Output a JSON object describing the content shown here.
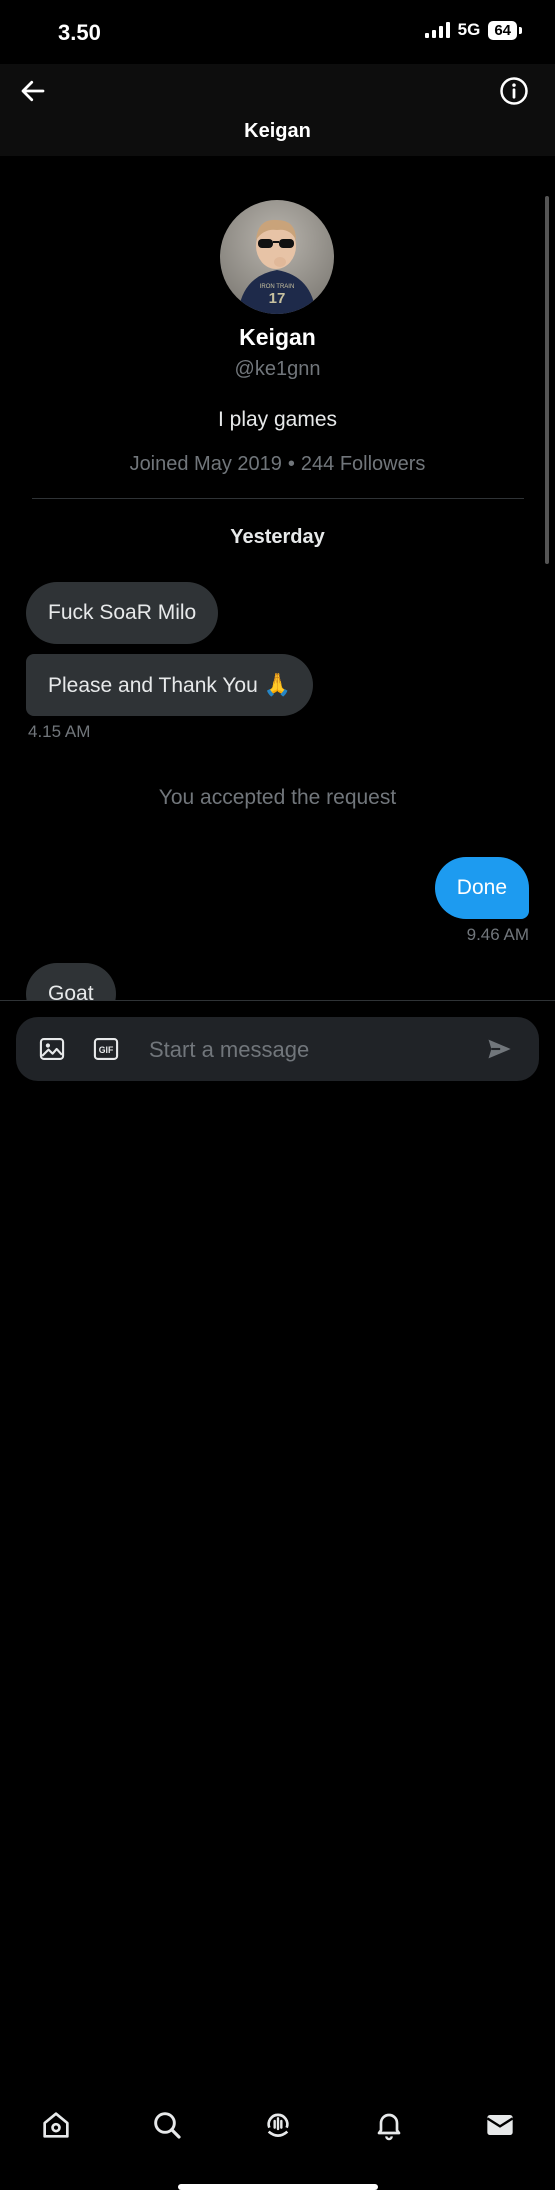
{
  "status_bar": {
    "time": "3.50",
    "network": "5G",
    "battery": "64"
  },
  "header": {
    "title": "Keigan"
  },
  "profile": {
    "name": "Keigan",
    "handle": "@ke1gnn",
    "bio": "I play games",
    "joined": "Joined May 2019",
    "followers": "244 Followers"
  },
  "conversation": {
    "day_label": "Yesterday",
    "messages": [
      {
        "text": "Fuck SoaR Milo",
        "direction": "received"
      },
      {
        "text": "Please and Thank You",
        "emoji": "🙏",
        "direction": "received"
      }
    ],
    "received_time": "4.15 AM",
    "system_message": "You accepted the request",
    "sent": {
      "text": "Done",
      "time": "9.46 AM"
    },
    "partial_message": "Goat"
  },
  "composer": {
    "placeholder": "Start a message",
    "gif_label": "GIF"
  },
  "nav": {
    "items": [
      "home-icon",
      "search-icon",
      "spaces-icon",
      "notifications-icon",
      "messages-icon"
    ]
  },
  "colors": {
    "accent": "#1d9bf0",
    "bubble": "#2f3336",
    "muted": "#71767b",
    "background": "#000000"
  }
}
